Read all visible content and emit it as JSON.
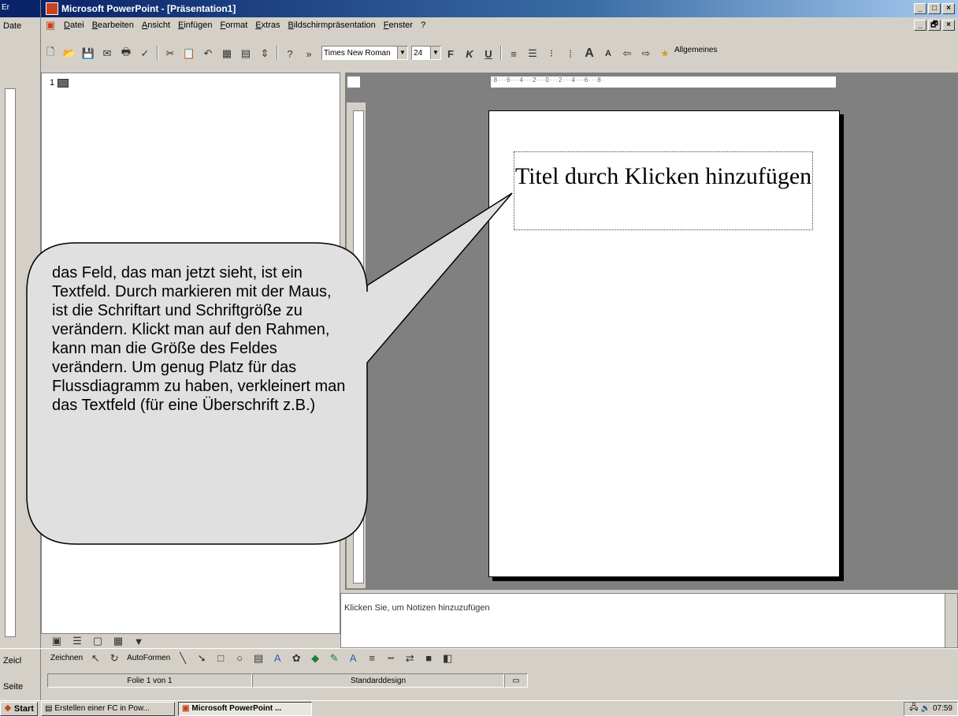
{
  "window": {
    "title": "Microsoft PowerPoint - [Präsentation1]",
    "controls": [
      "_",
      "□",
      "×"
    ]
  },
  "background_window": {
    "title": "Er",
    "menu_label": "Date",
    "drawing_label": "Zeicl",
    "status_label": "Seite"
  },
  "menu": {
    "items": [
      "Datei",
      "Bearbeiten",
      "Ansicht",
      "Einfügen",
      "Format",
      "Extras",
      "Bildschirmpräsentation",
      "Fenster",
      "?"
    ],
    "doc_controls": [
      "_",
      "🗗",
      "×"
    ]
  },
  "formatting": {
    "font_name": "Times New Roman",
    "font_size": "24",
    "bold_label": "F",
    "italic_label": "K",
    "underline_label": "U",
    "design_label": "Allgemeines",
    "more_label": "»"
  },
  "outline": {
    "slide_number": "1"
  },
  "slide": {
    "title_placeholder": "Titel durch Klicken hinzufügen",
    "ruler_text": "·8···6···4···2···0···2···4···6···8·"
  },
  "notes": {
    "placeholder": "Klicken Sie, um Notizen hinzuzufügen"
  },
  "drawing": {
    "draw_label": "Zeichnen",
    "autoshapes_label": "AutoFormen"
  },
  "status": {
    "slide_info": "Folie 1 von 1",
    "design": "Standarddesign"
  },
  "taskbar": {
    "start_label": "Start",
    "task1": "Erstellen einer FC in Pow...",
    "task2": "Microsoft PowerPoint ...",
    "clock": "07:59"
  },
  "callout": {
    "text": "das Feld, das man jetzt sieht, ist ein Textfeld. Durch markieren mit der Maus, ist die Schriftart und Schriftgröße zu verändern. Klickt man auf den Rahmen, kann man die Größe des Feldes verändern. Um genug Platz für das Flussdiagramm zu haben, verkleinert man das Textfeld (für eine Überschrift z.B.)"
  },
  "colors": {
    "title_bar": "#0a246a",
    "chrome": "#d4d0c8",
    "slide_bg": "#808080",
    "callout_fill": "#e0e0e0"
  }
}
